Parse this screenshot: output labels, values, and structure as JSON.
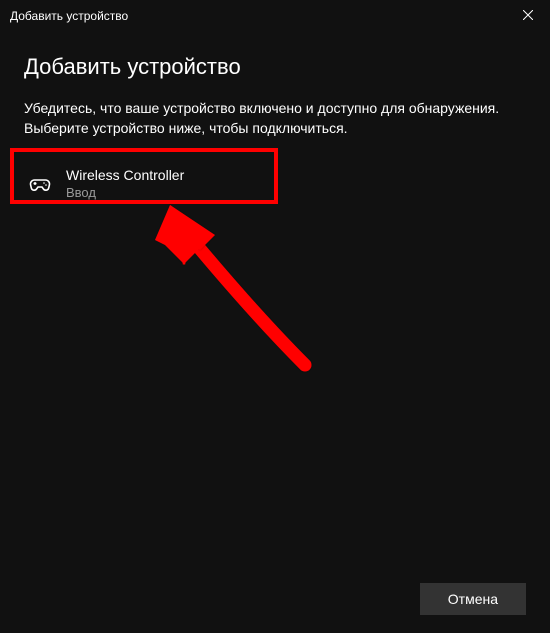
{
  "titlebar": {
    "title": "Добавить устройство"
  },
  "heading": "Добавить устройство",
  "instructions": "Убедитесь, что ваше устройство включено и доступно для обнаружения. Выберите устройство ниже, чтобы подключиться.",
  "devices": [
    {
      "name": "Wireless Controller",
      "subtitle": "Ввод",
      "icon": "gamepad-icon"
    }
  ],
  "footer": {
    "cancel_label": "Отмена"
  },
  "annotation": {
    "highlight_color": "#ff0000"
  }
}
